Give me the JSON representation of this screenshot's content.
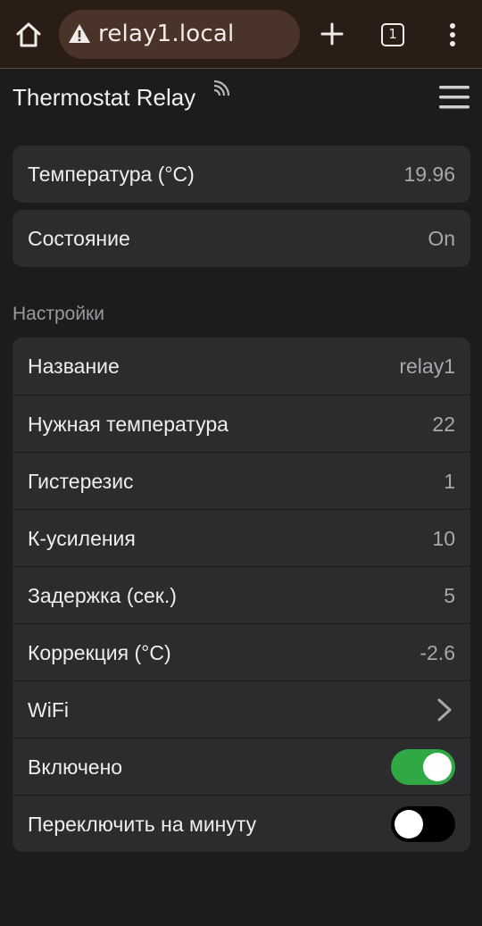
{
  "browser": {
    "url": "relay1.local",
    "tab_count": "1",
    "icons": [
      "home-icon",
      "warning-icon",
      "plus-icon",
      "tabs-icon",
      "more-vert-icon"
    ]
  },
  "header": {
    "title": "Thermostat Relay",
    "icons": [
      "wifi-signal-icon",
      "hamburger-menu-icon"
    ]
  },
  "status": {
    "rows": [
      {
        "label": "Температура (°C)",
        "value": "19.96"
      },
      {
        "label": "Состояние",
        "value": "On"
      }
    ]
  },
  "settings": {
    "section_title": "Настройки",
    "rows": [
      {
        "label": "Название",
        "value": "relay1"
      },
      {
        "label": "Нужная температура",
        "value": "22"
      },
      {
        "label": "Гистерезис",
        "value": "1"
      },
      {
        "label": "К-усиления",
        "value": "10"
      },
      {
        "label": "Задержка (сек.)",
        "value": "5"
      },
      {
        "label": "Коррекция (°C)",
        "value": "-2.6"
      },
      {
        "label": "WiFi",
        "value": ""
      },
      {
        "label": "Включено",
        "toggle": true
      },
      {
        "label": "Переключить на минуту",
        "toggle": false
      }
    ]
  },
  "colors": {
    "background": "#1c1c1e",
    "card": "#2c2c2f",
    "toggle_on": "#30a845",
    "browser_bar": "#2a1d16"
  }
}
